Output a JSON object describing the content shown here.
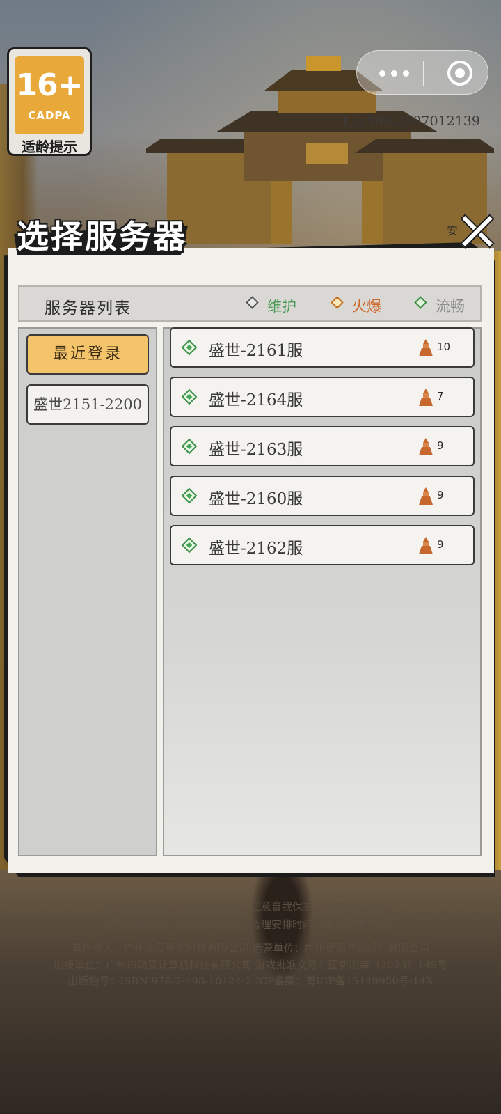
{
  "age_rating": {
    "rating": "16+",
    "org": "CADPA",
    "tip": "适龄提示"
  },
  "version": "1.0.106.2507012139",
  "dialog": {
    "title": "选择服务器",
    "partial_label": "安",
    "list_header": "服务器列表",
    "legend": [
      {
        "label": "维护",
        "color": "#4a9a55",
        "icon": "gray-diamond-icon"
      },
      {
        "label": "火爆",
        "color": "#d0672a",
        "icon": "orange-diamond-icon"
      },
      {
        "label": "流畅",
        "color": "#8a8a8a",
        "icon": "green-diamond-icon"
      }
    ],
    "categories": [
      {
        "label": "最近登录",
        "active": true
      },
      {
        "label": "盛世2151-2200",
        "active": false
      }
    ],
    "servers": [
      {
        "name": "盛世-2161服",
        "count": "10",
        "status": "流畅"
      },
      {
        "name": "盛世-2164服",
        "count": "7",
        "status": "流畅"
      },
      {
        "name": "盛世-2163服",
        "count": "9",
        "status": "流畅"
      },
      {
        "name": "盛世-2160服",
        "count": "9",
        "status": "流畅"
      },
      {
        "name": "盛世-2162服",
        "count": "9",
        "status": "流畅"
      }
    ]
  },
  "footer": {
    "line1": "抵制不良游戏，拒绝盗版游戏。注意自我保护，谨防受骗上当。",
    "line2": "适度游戏益脑，沉迷游戏伤身。合理安排时间，享受健康生活。",
    "line3": "著作权人：广州北辰星光科技有限公司   运营单位：广州灵犀互动娱乐有限公司",
    "line4": "出版单位：广州市动景计算机科技有限公司   游戏批准文号：国新出审〔2023〕149号",
    "line5": "出版物号：ISBN 978-7-498-10124-2   ICP备案：粤ICP备15149950号-14X"
  },
  "colors": {
    "accent": "#f4c46a",
    "panel": "#f2f1ec",
    "border": "#1c1c1c"
  }
}
